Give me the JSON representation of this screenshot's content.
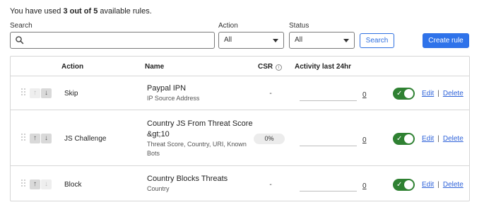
{
  "usage": {
    "prefix": "You have used ",
    "count": "3 out of 5",
    "suffix": " available rules."
  },
  "filters": {
    "search_label": "Search",
    "search_placeholder": "",
    "action_label": "Action",
    "action_value": "All",
    "status_label": "Status",
    "status_value": "All",
    "search_button": "Search",
    "create_button": "Create rule"
  },
  "table": {
    "headers": {
      "action": "Action",
      "name": "Name",
      "csr": "CSR",
      "csr_info": "i",
      "activity": "Activity last 24hr"
    },
    "rows": [
      {
        "action": "Skip",
        "name": "Paypal IPN",
        "description": "IP Source Address",
        "csr": "-",
        "activity_count": "0",
        "enabled": true,
        "edit": "Edit",
        "delete": "Delete"
      },
      {
        "action": "JS Challenge",
        "name": "Country JS From Threat Score &gt;10",
        "description": "Threat Score, Country, URI, Known Bots",
        "csr": "0%",
        "activity_count": "0",
        "enabled": true,
        "edit": "Edit",
        "delete": "Delete"
      },
      {
        "action": "Block",
        "name": "Country Blocks Threats",
        "description": "Country",
        "csr": "-",
        "activity_count": "0",
        "enabled": true,
        "edit": "Edit",
        "delete": "Delete"
      }
    ]
  },
  "colors": {
    "primary": "#2f73ea",
    "toggle_on": "#2f8132",
    "link": "#2e62d9",
    "border": "#d6d6d6"
  },
  "icons": {
    "search": "search-icon",
    "caret": "chevron-down-icon",
    "drag": "drag-handle-icon",
    "up": "arrow-up-icon",
    "down": "arrow-down-icon",
    "check": "check-icon",
    "info": "info-icon"
  }
}
